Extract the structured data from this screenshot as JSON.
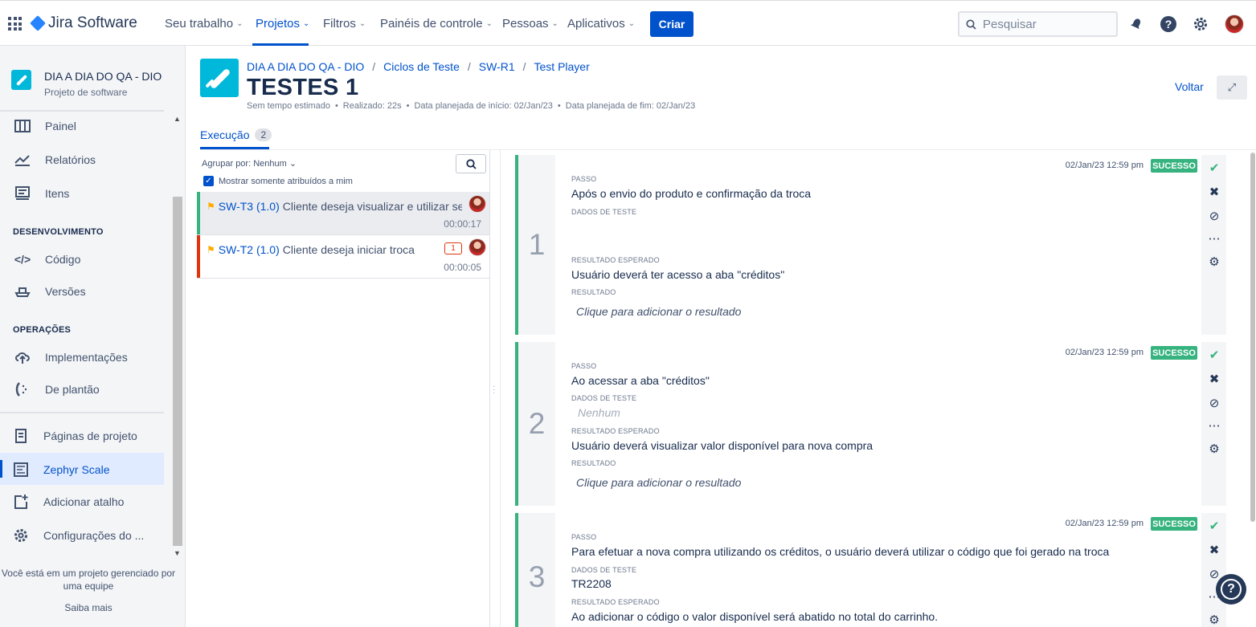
{
  "topnav": {
    "logo": "Jira Software",
    "items": [
      "Seu trabalho",
      "Projetos",
      "Filtros",
      "Painéis de controle",
      "Pessoas",
      "Aplicativos"
    ],
    "create_label": "Criar",
    "search_placeholder": "Pesquisar"
  },
  "sidebar": {
    "project_name": "DIA A DIA DO QA - DIO",
    "project_type": "Projeto de software",
    "planning": [
      "Painel",
      "Relatórios",
      "Itens"
    ],
    "dev_section": "DESENVOLVIMENTO",
    "dev_items": [
      "Código",
      "Versões"
    ],
    "ops_section": "OPERAÇÕES",
    "ops_items": [
      "Implementações",
      "De plantão"
    ],
    "extra_items": [
      "Páginas de projeto",
      "Zephyr Scale",
      "Adicionar atalho",
      "Configurações do ..."
    ],
    "footer_text": "Você está em um projeto gerenciado por uma equipe",
    "footer_link": "Saiba mais"
  },
  "header": {
    "breadcrumb": [
      "DIA A DIA DO QA - DIO",
      "Ciclos de Teste",
      "SW-R1",
      "Test Player"
    ],
    "title": "TESTES 1",
    "meta": [
      "Sem tempo estimado",
      "Realizado: 22s",
      "Data planejada de início: 02/Jan/23",
      "Data planejada de fim: 02/Jan/23"
    ],
    "back_label": "Voltar",
    "tab_label": "Execução",
    "tab_count": "2"
  },
  "list": {
    "group_by": "Agrupar por: Nenhum",
    "only_mine": "Mostrar somente atribuídos a mim",
    "cases": [
      {
        "key": "SW-T3 (1.0)",
        "name": "Cliente deseja visualizar e utilizar seus créditos",
        "time": "00:00:17",
        "issues": "",
        "color": "#36b37e"
      },
      {
        "key": "SW-T2 (1.0)",
        "name": "Cliente deseja iniciar troca",
        "time": "00:00:05",
        "issues": "1",
        "color": "#de350b"
      }
    ]
  },
  "labels": {
    "step": "PASSO",
    "test_data": "DADOS DE TESTE",
    "expected": "RESULTADO ESPERADO",
    "result": "RESULTADO",
    "result_placeholder": "Clique para adicionar o resultado",
    "none": "Nenhum"
  },
  "steps": [
    {
      "num": "1",
      "timestamp": "02/Jan/23 12:59 pm",
      "status": "SUCESSO",
      "step": "Após o envio do produto e confirmação da troca",
      "data": "",
      "expected": "Usuário deverá ter acesso a aba \"créditos\""
    },
    {
      "num": "2",
      "timestamp": "02/Jan/23 12:59 pm",
      "status": "SUCESSO",
      "step": "Ao acessar a aba \"créditos\"",
      "data": "",
      "expected": "Usuário deverá visualizar valor disponível para nova compra"
    },
    {
      "num": "3",
      "timestamp": "02/Jan/23 12:59 pm",
      "status": "SUCESSO",
      "step": "Para efetuar a nova compra utilizando os créditos, o usuário deverá utilizar o código que foi gerado na troca",
      "data": "TR2208",
      "expected": "Ao adicionar o código o valor disponível será abatido no total do carrinho."
    }
  ],
  "colors": {
    "accent": "#0052cc",
    "success": "#36b37e",
    "fail": "#de350b"
  }
}
